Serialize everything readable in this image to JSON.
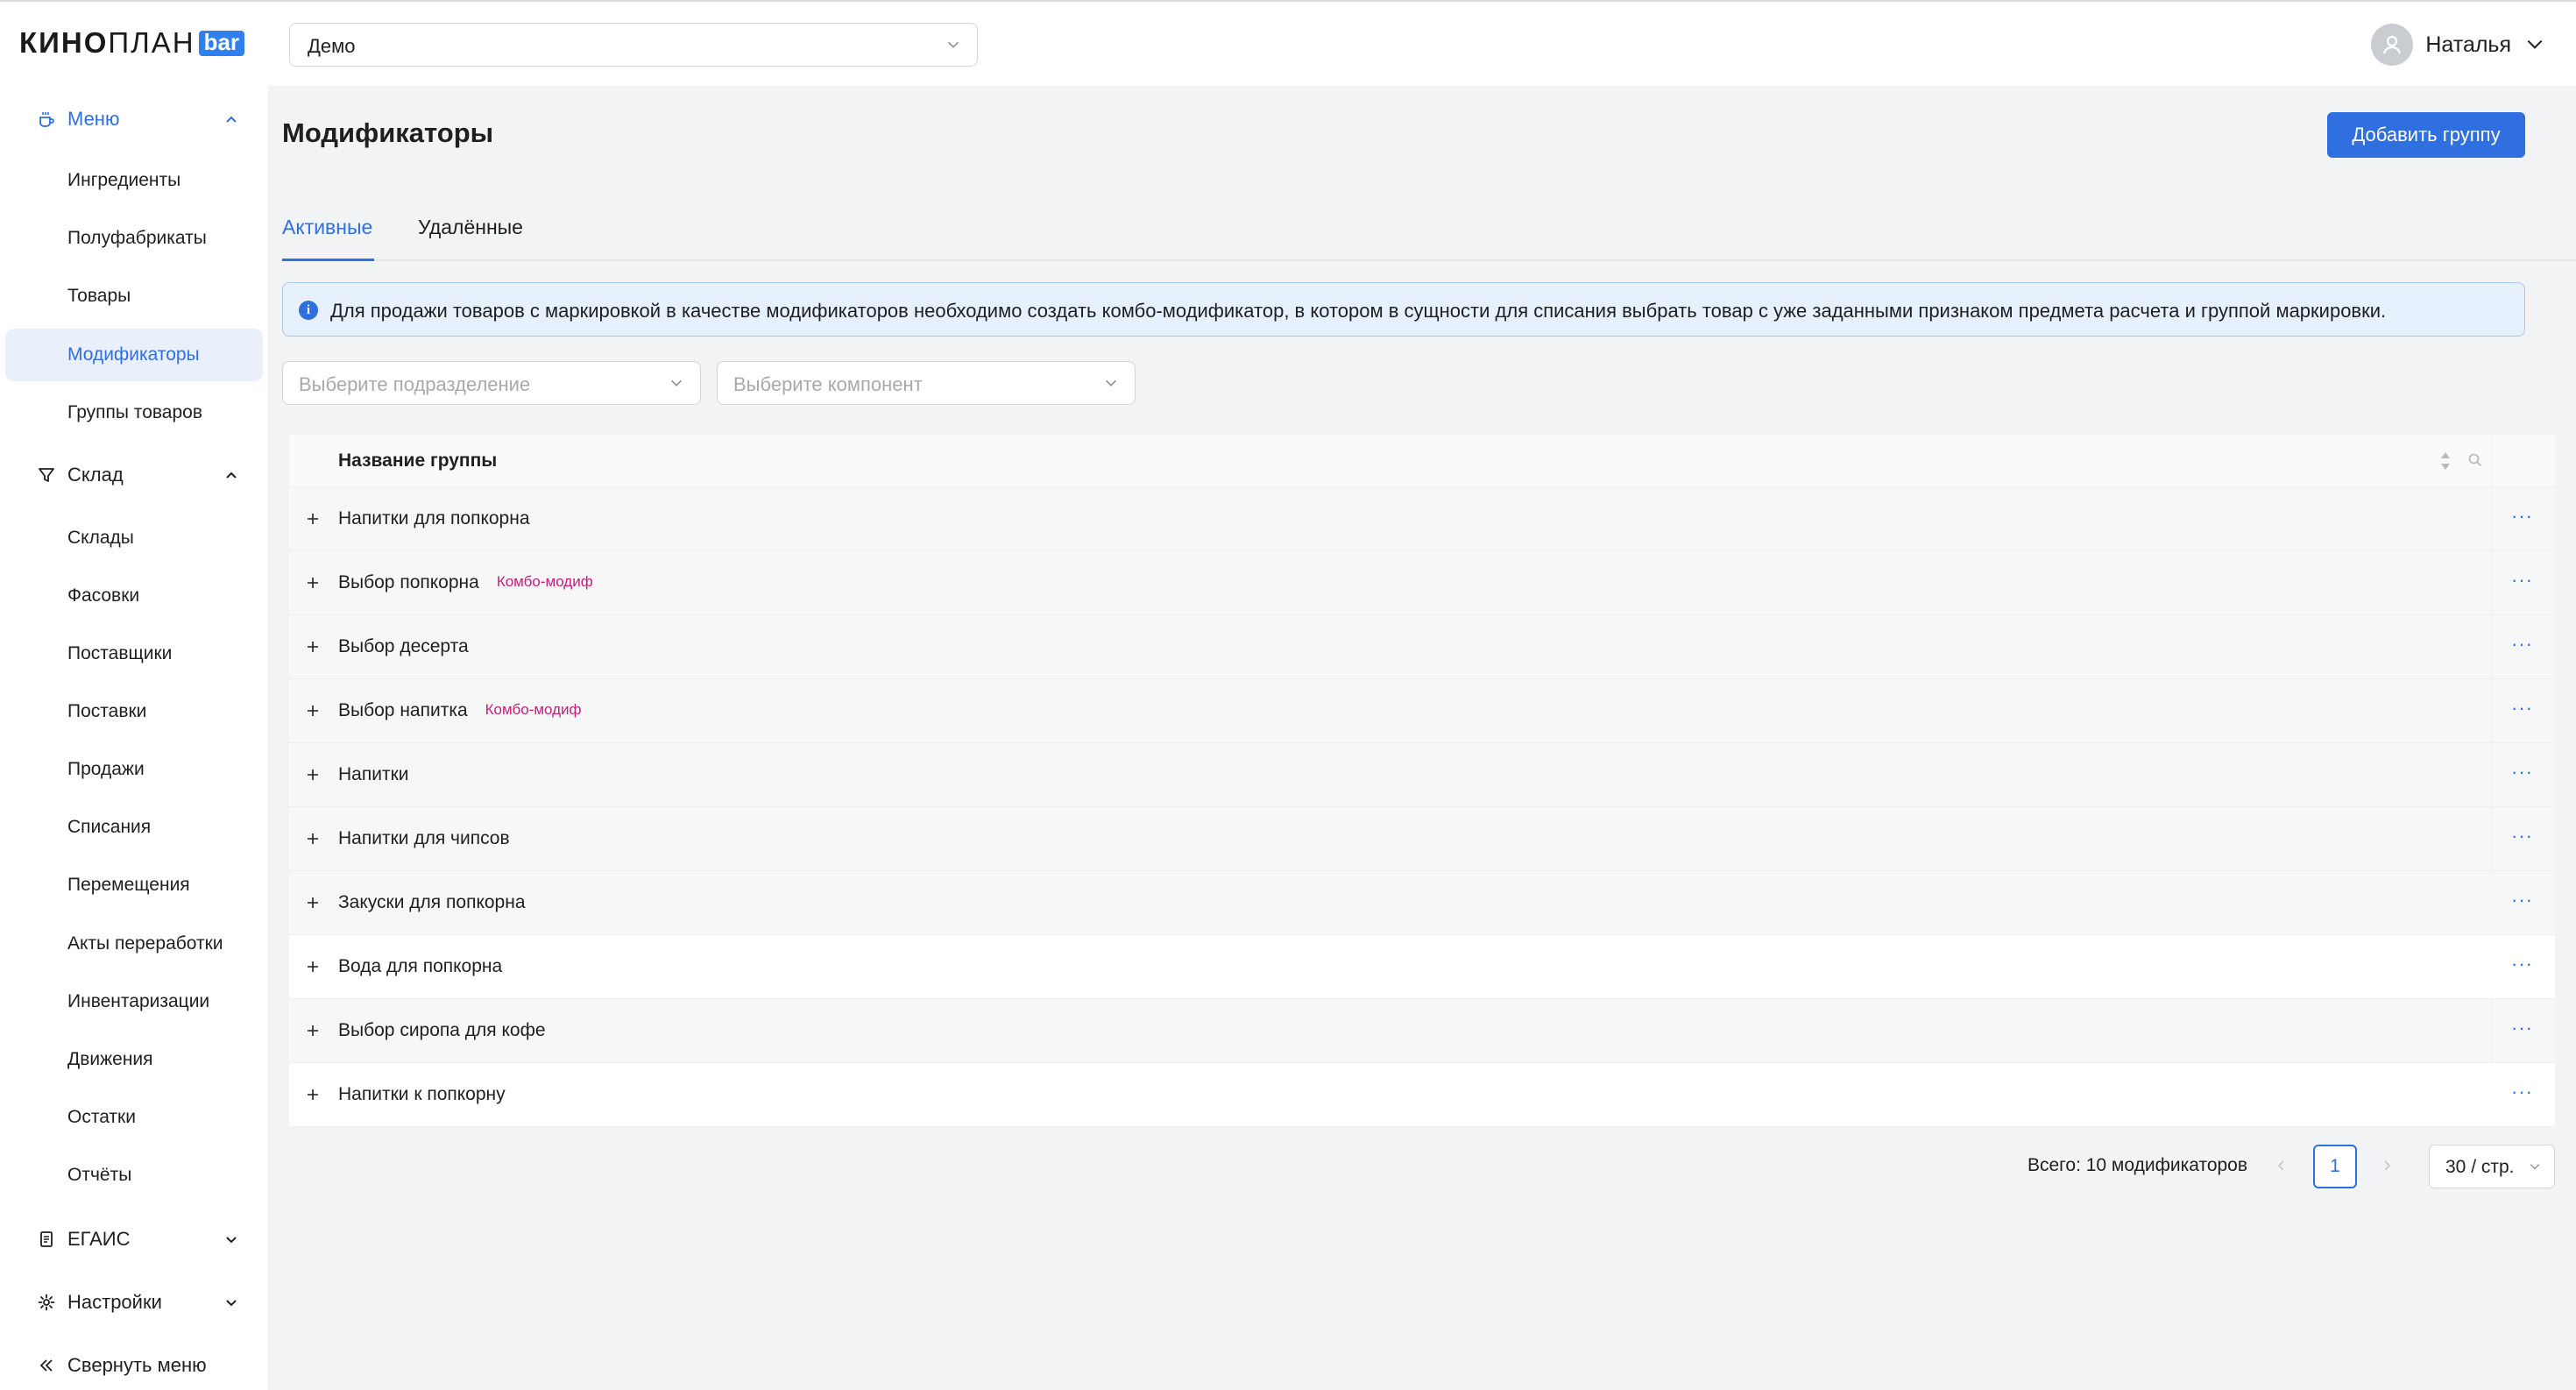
{
  "brand": {
    "logo_prefix": "КИНО",
    "logo_suffix": "ПЛАН",
    "logo_badge": "bar",
    "accent": "#2f6fe0"
  },
  "header": {
    "department_select": "Демо",
    "user_name": "Наталья"
  },
  "sidebar": {
    "menu": {
      "label": "Меню",
      "items": [
        "Ингредиенты",
        "Полуфабрикаты",
        "Товары",
        "Модификаторы",
        "Группы товаров"
      ],
      "selected": "Модификаторы"
    },
    "warehouse": {
      "label": "Склад",
      "items": [
        "Склады",
        "Фасовки",
        "Поставщики",
        "Поставки",
        "Продажи",
        "Списания",
        "Перемещения",
        "Акты переработки",
        "Инвентаризации",
        "Движения",
        "Остатки",
        "Отчёты"
      ]
    },
    "egais": {
      "label": "ЕГАИС"
    },
    "settings": {
      "label": "Настройки"
    },
    "collapse": {
      "label": "Свернуть меню"
    }
  },
  "page": {
    "title": "Модификаторы",
    "add_button": "Добавить группу",
    "tabs": [
      {
        "label": "Активные",
        "active": true
      },
      {
        "label": "Удалённые",
        "active": false
      }
    ],
    "alert": "Для продажи товаров с маркировкой в качестве модификаторов необходимо создать комбо-модификатор, в котором в сущности для списания выбрать товар с уже заданными признаком предмета расчета и группой маркировки.",
    "filters": {
      "subdivision_placeholder": "Выберите подразделение",
      "component_placeholder": "Выберите компонент"
    }
  },
  "table": {
    "column_header": "Название группы",
    "combo_tag": "Комбо-модиф",
    "rows": [
      {
        "name": "Напитки для попкорна",
        "combo": false
      },
      {
        "name": "Выбор попкорна",
        "combo": true
      },
      {
        "name": "Выбор десерта",
        "combo": false
      },
      {
        "name": "Выбор напитка",
        "combo": true
      },
      {
        "name": "Напитки",
        "combo": false
      },
      {
        "name": "Напитки для чипсов",
        "combo": false
      },
      {
        "name": "Закуски для попкорна",
        "combo": false
      },
      {
        "name": "Вода для попкорна",
        "combo": false
      },
      {
        "name": "Выбор сиропа для кофе",
        "combo": false
      },
      {
        "name": "Напитки к попкорну",
        "combo": false
      }
    ]
  },
  "pagination": {
    "total_text": "Всего: 10 модификаторов",
    "current_page": "1",
    "page_size": "30 / стр."
  }
}
